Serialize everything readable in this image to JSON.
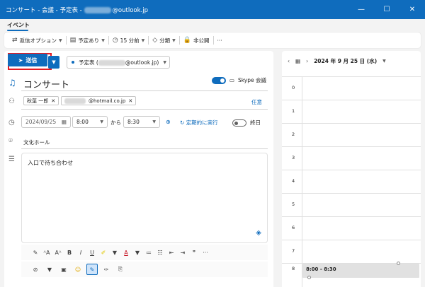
{
  "window": {
    "title_prefix": "コンサート - 会議 - 予定表 - ",
    "title_suffix": "@outlook.jp",
    "minimize": "—",
    "maximize": "☐",
    "close": "✕"
  },
  "tabs": [
    {
      "label": "イベント"
    }
  ],
  "ribbon": {
    "reply_options": "返信オプション",
    "busy": "予定あり",
    "reminder": "15 分前",
    "category": "分類",
    "private": "非公開",
    "more": "···"
  },
  "composer": {
    "send_label": "送信",
    "calendar_prefix": "予定表 (",
    "calendar_suffix": "@outlook.jp)",
    "title": "コンサート",
    "skype_label": "Skype 会議",
    "attendees": [
      {
        "name": "秋葉 一郎"
      },
      {
        "name": "@hotmail.co.jp"
      }
    ],
    "optional_label": "任意",
    "start_date": "2024/09/25",
    "start_time": "8:00",
    "from_label": "から",
    "end_time": "8:30",
    "recurrence_label": "定期的に実行",
    "allday_label": "終日",
    "location": "文化ホール",
    "body": "入口で待ち合わせ"
  },
  "calendar": {
    "date_label": "2024 年 9 月 25 日 (水)",
    "hours": [
      "0",
      "1",
      "2",
      "3",
      "4",
      "5",
      "6",
      "7",
      "8"
    ],
    "event_time": "8:00 - 8:30"
  },
  "colors": {
    "brand": "#0f6cbd",
    "highlight_box": "#e31b23"
  }
}
